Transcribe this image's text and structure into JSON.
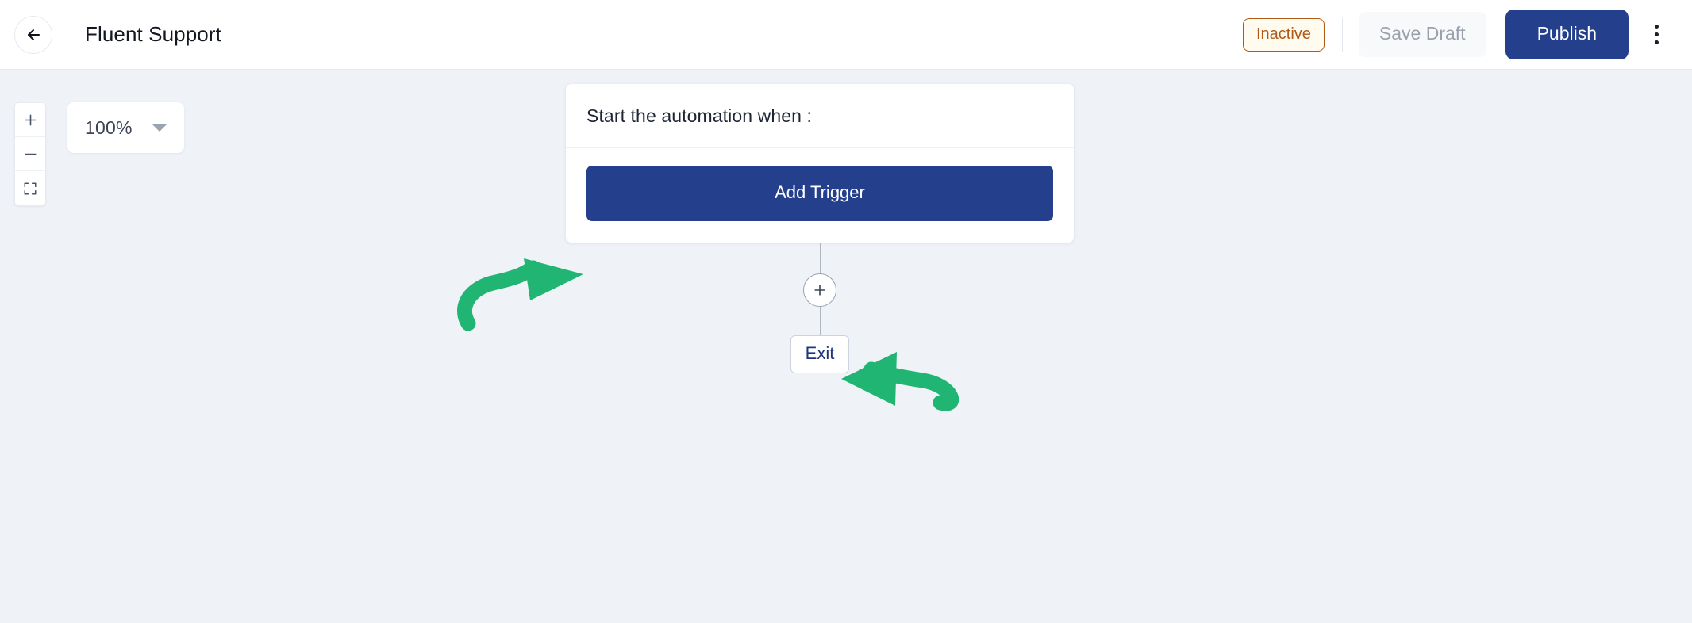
{
  "header": {
    "back_icon": "arrow-left-icon",
    "title": "Fluent Support",
    "status_badge": "Inactive",
    "save_draft_label": "Save Draft",
    "publish_label": "Publish",
    "menu_icon": "kebab-menu-icon"
  },
  "canvas": {
    "zoom_controls": {
      "zoom_in_icon": "plus-icon",
      "zoom_out_icon": "minus-icon",
      "fit_view_icon": "fit-screen-icon"
    },
    "zoom_level": {
      "value": "100%",
      "caret_icon": "chevron-down-icon"
    },
    "trigger_card": {
      "header_label": "Start the automation when :",
      "add_trigger_label": "Add Trigger"
    },
    "add_node": {
      "icon": "plus-icon"
    },
    "exit_node": {
      "label": "Exit"
    }
  },
  "annotations": {
    "arrow_color": "#21b573",
    "arrow_to_add_trigger": "curved-arrow-pointing-right",
    "arrow_to_add_node": "curved-arrow-pointing-left"
  },
  "colors": {
    "primary": "#24408c",
    "canvas_background": "#eff3f8",
    "status_accent": "#b05a17",
    "annotation_green": "#21b573"
  }
}
